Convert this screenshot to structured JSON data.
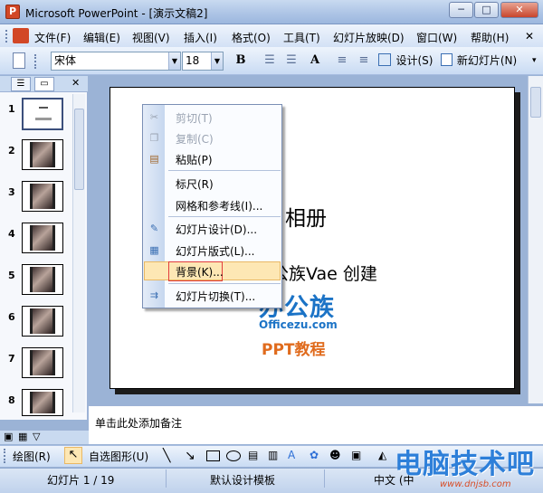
{
  "window": {
    "title": "Microsoft PowerPoint - [演示文稿2]",
    "app_icon_label": "P",
    "min_label": "─",
    "restore_label": "□",
    "close_label": "✕"
  },
  "menu": {
    "items": [
      "文件(F)",
      "编辑(E)",
      "视图(V)",
      "插入(I)",
      "格式(O)",
      "工具(T)",
      "幻灯片放映(D)",
      "窗口(W)",
      "帮助(H)"
    ],
    "close_doc_label": "✕"
  },
  "toolbar": {
    "font": "宋体",
    "size": "18",
    "bold": "B",
    "font_grow": "A",
    "design": "设计(S)",
    "new_slide": "新幻灯片(N)"
  },
  "left_panel": {
    "tab_outline": "☰",
    "tab_slides": "▭",
    "close": "✕",
    "slide_numbers": [
      "1",
      "2",
      "3",
      "4",
      "5",
      "6",
      "7",
      "8"
    ]
  },
  "slide": {
    "title": "相册",
    "subtitle": "公族Vae 创建",
    "logo_main": "办公族",
    "logo_url": "Officezu.com",
    "logo_sub": "PPT教程"
  },
  "context_menu": {
    "cut": "剪切(T)",
    "copy": "复制(C)",
    "paste": "粘贴(P)",
    "ruler": "标尺(R)",
    "grid": "网格和参考线(I)...",
    "slide_design": "幻灯片设计(D)...",
    "slide_layout": "幻灯片版式(L)...",
    "background": "背景(K)...",
    "transition": "幻灯片切换(T)..."
  },
  "notes": {
    "placeholder": "单击此处添加备注"
  },
  "drawing_toolbar": {
    "draw": "绘图(R)",
    "autoshapes": "自选图形(U)"
  },
  "status_bar": {
    "slide_pos": "幻灯片 1 / 19",
    "design": "默认设计模板",
    "language": "中文 (中"
  },
  "watermark": {
    "text": "电脑技术吧",
    "url": "www.dnjsb.com"
  }
}
